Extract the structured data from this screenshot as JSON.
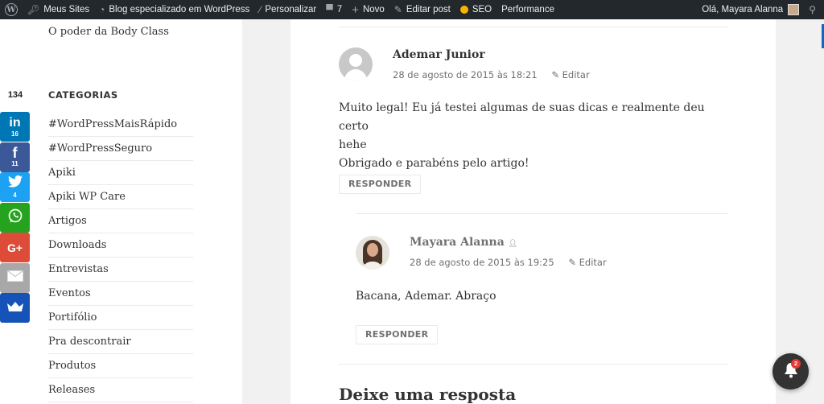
{
  "adminbar": {
    "items": [
      {
        "icon": "wordpress-logo-icon",
        "label": ""
      },
      {
        "icon": "key-icon",
        "label": "Meus Sites"
      },
      {
        "icon": "dashboard-icon",
        "label": "Blog especializado em WordPress"
      },
      {
        "icon": "brush-icon",
        "label": "Personalizar"
      },
      {
        "icon": "comment-icon",
        "label": "7"
      },
      {
        "icon": "plus-icon",
        "label": "Novo"
      },
      {
        "icon": "pencil-icon",
        "label": "Editar post"
      },
      {
        "icon": "seo-status-dot-icon",
        "label": "SEO",
        "color": "#f4b400"
      },
      {
        "icon": "",
        "label": "Performance"
      }
    ],
    "greeting": "Olá, Mayara Alanna",
    "search_icon": "search-icon"
  },
  "sidebar": {
    "recent_post": "O poder da Body Class",
    "categories_title": "CATEGORIAS",
    "categories": [
      "#WordPressMaisRápido",
      "#WordPressSeguro",
      "Apiki",
      "Apiki WP Care",
      "Artigos",
      "Downloads",
      "Entrevistas",
      "Eventos",
      "Portifólio",
      "Pra descontrair",
      "Produtos",
      "Releases"
    ]
  },
  "share": {
    "total": "134",
    "buttons": [
      {
        "network": "linkedin",
        "glyph": "in",
        "count": "16",
        "color": "#0077b5"
      },
      {
        "network": "facebook",
        "glyph": "f",
        "count": "11",
        "color": "#3b5998"
      },
      {
        "network": "twitter",
        "glyph": "🐦",
        "count": "4",
        "color": "#1da1f2"
      },
      {
        "network": "whatsapp",
        "glyph": "✆",
        "count": "",
        "color": "#25a31e"
      },
      {
        "network": "google-plus",
        "glyph": "G+",
        "count": "",
        "color": "#dd4b39"
      },
      {
        "network": "email",
        "glyph": "✉",
        "count": "",
        "color": "#a8a8a8"
      },
      {
        "network": "sumome",
        "glyph": "♛",
        "count": "",
        "color": "#1553b8"
      }
    ]
  },
  "comments": [
    {
      "author": "Ademar Junior",
      "date": "28 de agosto de 2015 às 18:21",
      "edit_label": "Editar",
      "text_lines": [
        "Muito legal! Eu já testei algumas de suas dicas e realmente deu certo",
        "hehe",
        "Obrigado e parabéns pelo artigo!"
      ],
      "reply_label": "RESPONDER"
    },
    {
      "author": "Mayara Alanna",
      "date": "28 de agosto de 2015 às 19:25",
      "edit_label": "Editar",
      "text_lines": [
        "Bacana, Ademar. Abraço"
      ],
      "reply_label": "RESPONDER"
    }
  ],
  "reply_section_title": "Deixe uma resposta",
  "notifications": {
    "count": "2"
  }
}
